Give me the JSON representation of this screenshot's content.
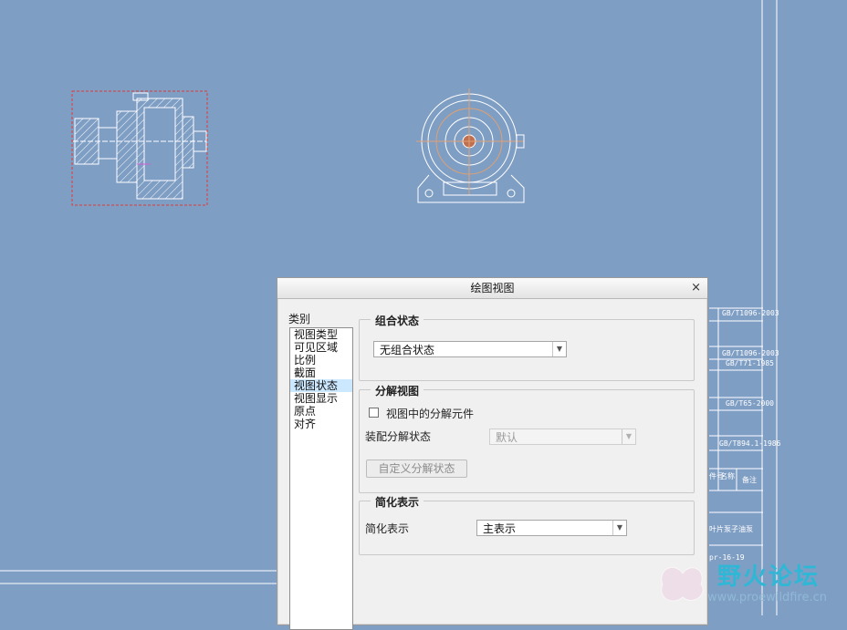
{
  "dialog": {
    "title": "绘图视图",
    "close_glyph": "×",
    "category_label": "类别",
    "categories": [
      "视图类型",
      "可见区域",
      "比例",
      "截面",
      "视图状态",
      "视图显示",
      "原点",
      "对齐"
    ],
    "selected_category": "视图状态"
  },
  "combined_state": {
    "legend": "组合状态",
    "value": "无组合状态"
  },
  "exploded_view": {
    "legend": "分解视图",
    "checkbox_label": "视图中的分解元件",
    "checked": false,
    "assembly_state_label": "装配分解状态",
    "assembly_state_value": "默认",
    "custom_button": "自定义分解状态"
  },
  "simplified": {
    "legend": "简化表示",
    "label": "简化表示",
    "value": "主表示"
  },
  "title_block": {
    "rows": [
      "GB/T1096-2003",
      "GB/T1096-2003",
      "GB/T71-1985",
      "GB/T65-2000",
      "GB/T894.1-1986"
    ],
    "cell_a": "件号",
    "cell_b": "名称",
    "cell_c": "备注",
    "part_name": "叶片泵子油泵",
    "date": "pr-16-19"
  },
  "watermark": {
    "name": "野火论坛",
    "url": "www.proewildfire.cn"
  },
  "colors": {
    "background": "#7f9ec4",
    "selection_box": "#e23a3a",
    "list_selection": "#cce8ff"
  }
}
